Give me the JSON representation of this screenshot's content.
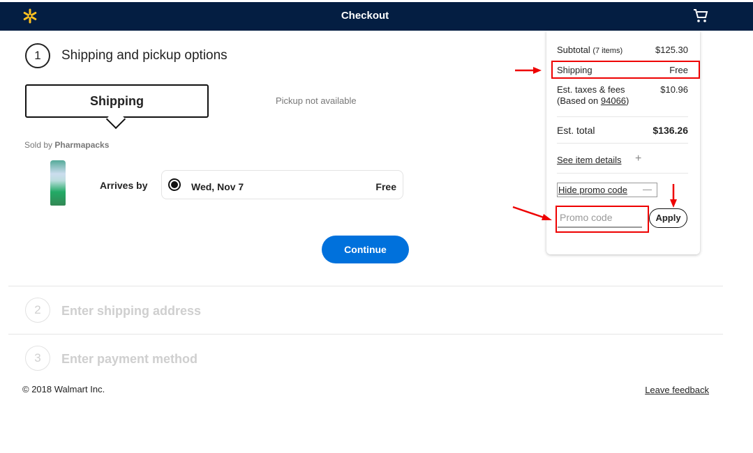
{
  "header": {
    "title": "Checkout",
    "logo": "walmart-spark-icon",
    "cart_icon": "cart-icon"
  },
  "step1": {
    "number": "1",
    "title": "Shipping and pickup options",
    "tab_shipping": "Shipping",
    "pickup": "Pickup not available",
    "sold_by_prefix": "Sold by ",
    "seller": "Pharmapacks",
    "arrives_label": "Arrives by",
    "date": "Wed, Nov 7",
    "price": "Free",
    "continue": "Continue"
  },
  "step2": {
    "number": "2",
    "title": "Enter shipping address"
  },
  "step3": {
    "number": "3",
    "title": "Enter payment method"
  },
  "footer": {
    "copyright": "© 2018 Walmart Inc.",
    "feedback": "Leave feedback"
  },
  "summary": {
    "subtotal_label": "Subtotal",
    "items": "(7 items)",
    "subtotal": "$125.30",
    "shipping_label": "Shipping",
    "shipping": "Free",
    "taxes_label": "Est. taxes & fees",
    "based_on": "(Based on ",
    "zip": "94066",
    "close_paren": ")",
    "taxes": "$10.96",
    "total_label": "Est. total",
    "total": "$136.26",
    "see_items": "See item details",
    "hide_promo": "Hide promo code",
    "promo_placeholder": "Promo code",
    "apply": "Apply"
  },
  "colors": {
    "header": "#041e42",
    "accent": "#0071dc",
    "spark": "#ffc220",
    "annotation": "#e00000"
  }
}
